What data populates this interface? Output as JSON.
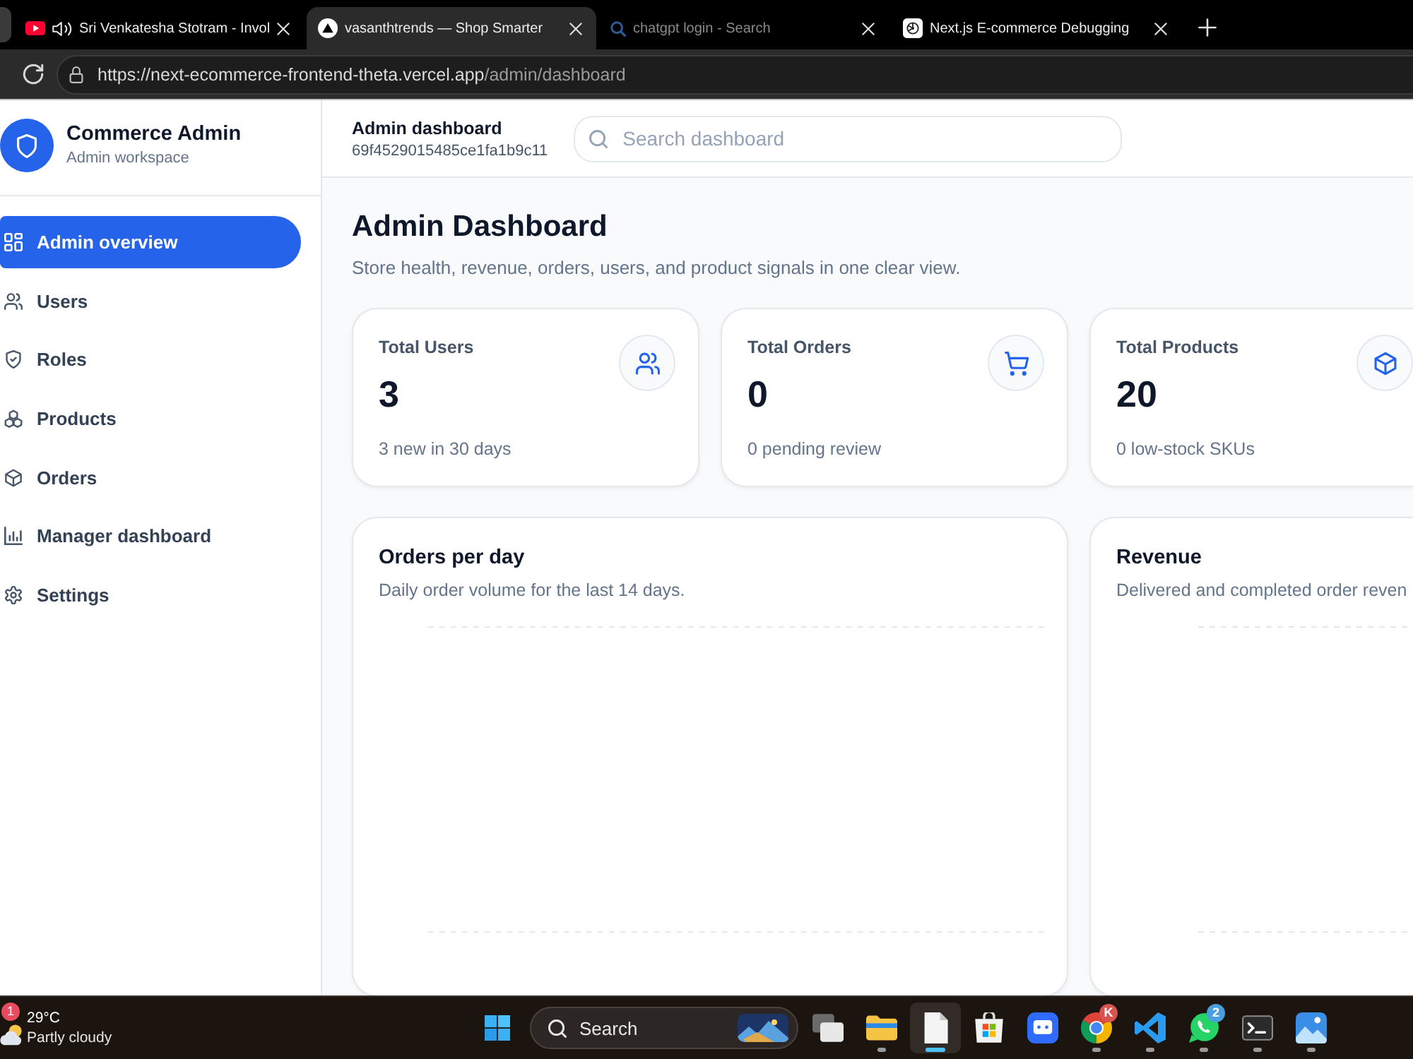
{
  "browser": {
    "tabs": [
      {
        "title": "Sri Venkatesha Stotram - Invol",
        "kind": "video",
        "audio": true,
        "sleeping": false,
        "selected": false
      },
      {
        "title": "vasanthtrends — Shop Smarter",
        "kind": "site",
        "audio": false,
        "sleeping": false,
        "selected": true
      },
      {
        "title": "chatgpt login - Search",
        "kind": "search",
        "audio": false,
        "sleeping": true,
        "selected": false
      },
      {
        "title": "Next.js E-commerce Debugging",
        "kind": "chat",
        "audio": false,
        "sleeping": false,
        "selected": false
      }
    ],
    "address_bar": {
      "url_host": "https://next-ecommerce-frontend-theta.vercel.app",
      "url_path": "/admin/dashboard"
    }
  },
  "sidebar": {
    "brand": {
      "title": "Commerce Admin",
      "subtitle": "Admin workspace"
    },
    "items": [
      {
        "kind": "overview",
        "label": "Admin overview",
        "selected": true
      },
      {
        "kind": "users",
        "label": "Users",
        "selected": false
      },
      {
        "kind": "roles",
        "label": "Roles",
        "selected": false
      },
      {
        "kind": "products",
        "label": "Products",
        "selected": false
      },
      {
        "kind": "orders",
        "label": "Orders",
        "selected": false
      },
      {
        "kind": "reports",
        "label": "Manager dashboard",
        "selected": false
      },
      {
        "kind": "settings",
        "label": "Settings",
        "selected": false
      }
    ]
  },
  "header": {
    "title": "Admin dashboard",
    "id": "69f4529015485ce1fa1b9c11",
    "search": {
      "placeholder": "Search dashboard"
    }
  },
  "page": {
    "title": "Admin Dashboard",
    "subtitle": "Store health, revenue, orders, users, and product signals in one clear view."
  },
  "stats": [
    {
      "kind": "users",
      "label": "Total Users",
      "value": "3",
      "note": "3 new in 30 days"
    },
    {
      "kind": "orders",
      "label": "Total Orders",
      "value": "0",
      "note": "0 pending review"
    },
    {
      "kind": "products",
      "label": "Total Products",
      "value": "20",
      "note": "0 low-stock SKUs"
    }
  ],
  "charts": [
    {
      "title": "Orders per day",
      "subtitle": "Daily order volume for the last 14 days."
    },
    {
      "title": "Revenue",
      "subtitle": "Delivered and completed order reven"
    }
  ],
  "taskbar": {
    "weather": {
      "temperature": "29°C",
      "condition": "Partly cloudy",
      "badge": "1"
    },
    "search": {
      "label": "Search"
    },
    "apps": [
      {
        "kind": "task-view",
        "running": false,
        "selected": false
      },
      {
        "kind": "files",
        "running": true,
        "selected": false
      },
      {
        "kind": "notes",
        "running": true,
        "selected": true
      },
      {
        "kind": "store",
        "running": false,
        "selected": false
      },
      {
        "kind": "meeting",
        "running": false,
        "selected": false
      },
      {
        "kind": "browser",
        "running": true,
        "selected": false,
        "badge": "K"
      },
      {
        "kind": "code",
        "running": true,
        "selected": false
      },
      {
        "kind": "messenger",
        "running": true,
        "selected": false,
        "badge": "2"
      },
      {
        "kind": "terminal",
        "running": true,
        "selected": false
      },
      {
        "kind": "photos",
        "running": true,
        "selected": false
      }
    ]
  }
}
